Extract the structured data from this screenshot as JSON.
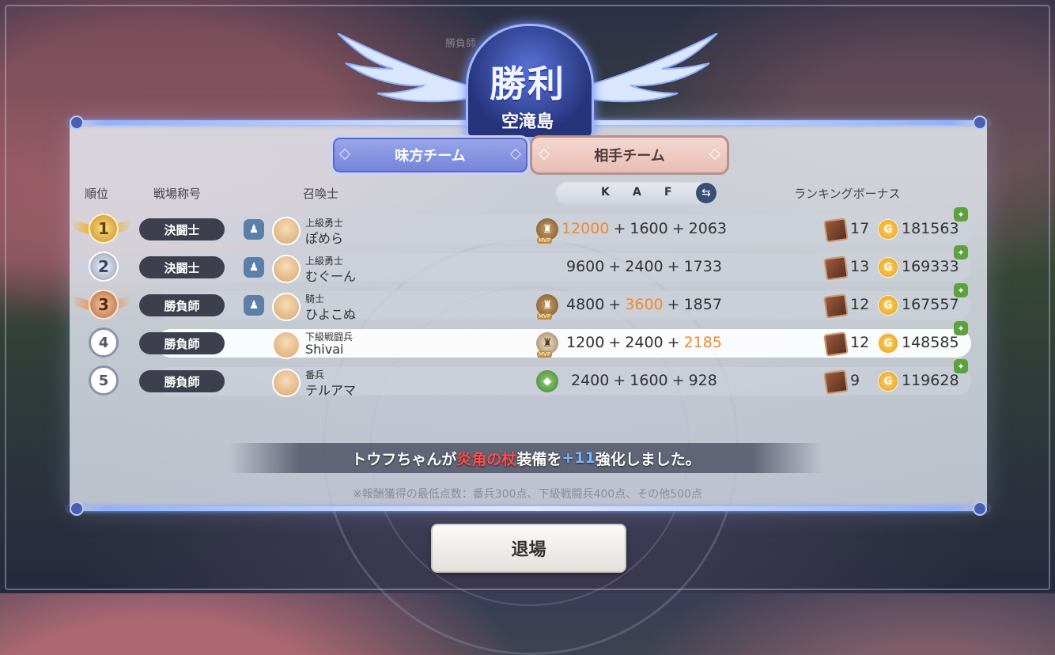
{
  "header": {
    "result": "勝利",
    "map": "空滝島",
    "ghost_text": "勝負師"
  },
  "tabs": {
    "ally": "味方チーム",
    "enemy": "相手チーム"
  },
  "columns": {
    "rank": "順位",
    "title": "戦場称号",
    "summoner": "召喚士",
    "k": "K",
    "a": "A",
    "f": "F",
    "bonus": "ランキングボーナス"
  },
  "rows": [
    {
      "rank": "1",
      "title": "決闘士",
      "player_rank": "上級勇士",
      "name": "ぽめら",
      "badge": "mvp",
      "k": "12000",
      "a": "1600",
      "f": "2063",
      "highlight": "k",
      "chest": "17",
      "coins": "181563"
    },
    {
      "rank": "2",
      "title": "決闘士",
      "player_rank": "上級勇士",
      "name": "むぐーん",
      "badge": "",
      "k": "9600",
      "a": "2400",
      "f": "1733",
      "highlight": "",
      "chest": "13",
      "coins": "169333"
    },
    {
      "rank": "3",
      "title": "勝負師",
      "player_rank": "騎士",
      "name": "ひよこぬ",
      "badge": "mvp",
      "k": "4800",
      "a": "3600",
      "f": "1857",
      "highlight": "a",
      "chest": "12",
      "coins": "167557"
    },
    {
      "rank": "4",
      "title": "勝負師",
      "player_rank": "下級戦闘兵",
      "name": "Shivai",
      "badge": "mvp",
      "k": "1200",
      "a": "2400",
      "f": "2185",
      "highlight": "f",
      "chest": "12",
      "coins": "148585"
    },
    {
      "rank": "5",
      "title": "勝負師",
      "player_rank": "番兵",
      "name": "テルアマ",
      "badge": "leaf",
      "k": "2400",
      "a": "1600",
      "f": "928",
      "highlight": "",
      "chest": "9",
      "coins": "119628"
    }
  ],
  "mvp_label": "MVP",
  "message": {
    "p1": "トウフちゃんが",
    "item": "炎角の杖",
    "p2": "装備を",
    "level": "+11",
    "p3": "強化しました。"
  },
  "note": "※報酬獲得の最低点数：番兵300点、下級戦闘兵400点、その他500点",
  "exit_button": "退場",
  "colors": {
    "highlight": "#ef8a2c",
    "ally_tab": "#7b8ade",
    "enemy_tab": "#ecc6bd",
    "item_red": "#ff4c4c",
    "level_blue": "#78b6ff"
  }
}
